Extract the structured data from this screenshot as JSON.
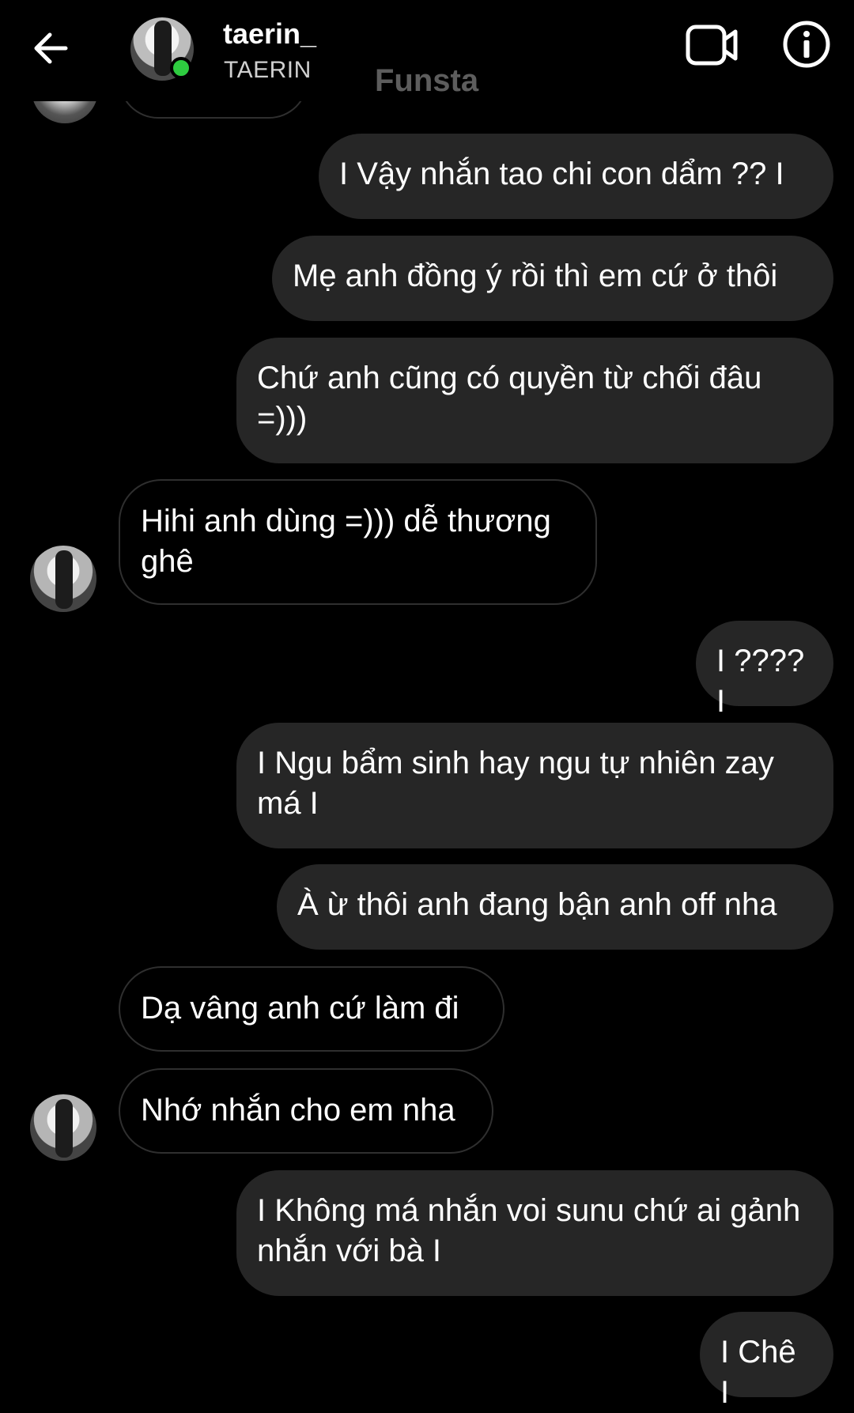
{
  "header": {
    "back_icon": "arrow-left-icon",
    "username": "taerin_",
    "subtitle": "TAERIN",
    "watermark": "Funsta",
    "online_color": "#2ecc40",
    "video_icon": "video-camera-icon",
    "info_icon": "info-icon"
  },
  "messages": [
    {
      "side": "out",
      "text": "I Vậy nhắn tao chi con dẩm ??  I"
    },
    {
      "side": "out",
      "text": "Mẹ anh đồng ý rồi thì em cứ ở thôi"
    },
    {
      "side": "out",
      "text": "Chứ anh cũng có quyền từ chối đâu =)))"
    },
    {
      "side": "in",
      "text": "Hihi anh dùng =))) dễ thương ghê"
    },
    {
      "side": "out",
      "text": "I ???? I"
    },
    {
      "side": "out",
      "text": "I Ngu bẩm sinh hay ngu tự nhiên zay má I"
    },
    {
      "side": "out",
      "text": "À ừ thôi anh đang bận anh off nha"
    },
    {
      "side": "in",
      "text": "Dạ vâng anh cứ làm đi"
    },
    {
      "side": "in",
      "text": "Nhớ nhắn cho em nha"
    },
    {
      "side": "out",
      "text": "I Không má nhắn voi sunu chứ ai gảnh nhắn với bà I"
    },
    {
      "side": "out",
      "text": "I Chê I"
    }
  ],
  "colors": {
    "background": "#000000",
    "outgoing_bubble": "#262626",
    "incoming_border": "#2f2f2f",
    "watermark": "#5d5d5d"
  }
}
